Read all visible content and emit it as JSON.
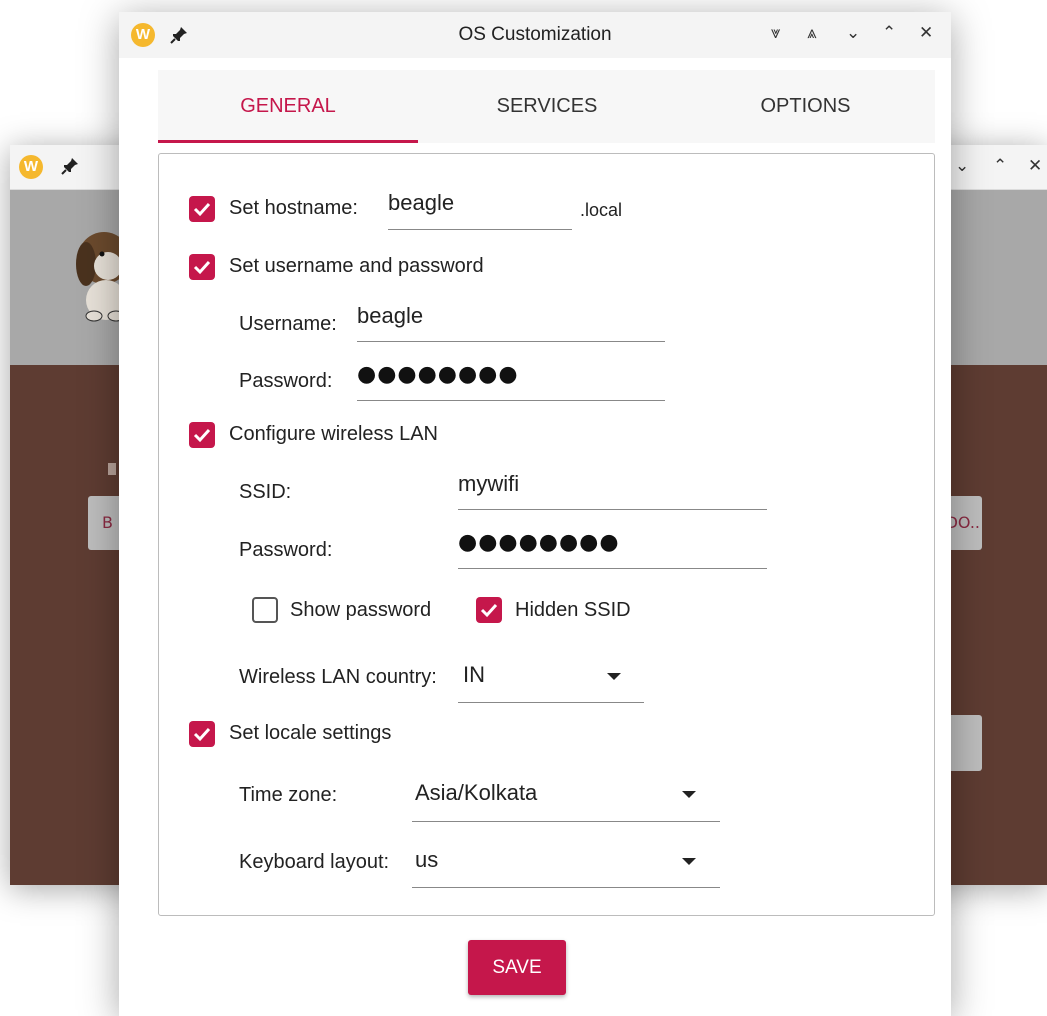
{
  "background_window": {
    "controls": [
      "⌄",
      "⌃",
      "✕"
    ],
    "partial_button_left": "B",
    "partial_button_right": "DO.."
  },
  "dialog": {
    "title": "OS Customization",
    "controls": [
      "⩔",
      "⩓",
      "⌄",
      "⌃",
      "✕"
    ]
  },
  "tabs": [
    {
      "label": "GENERAL",
      "active": true
    },
    {
      "label": "SERVICES",
      "active": false
    },
    {
      "label": "OPTIONS",
      "active": false
    }
  ],
  "general": {
    "hostname": {
      "label": "Set hostname:",
      "checked": true,
      "value": "beagle",
      "suffix": ".local"
    },
    "user": {
      "label": "Set username and password",
      "checked": true,
      "username_label": "Username:",
      "username_value": "beagle",
      "password_label": "Password:",
      "password_value": "●●●●●●●●"
    },
    "wlan": {
      "label": "Configure wireless LAN",
      "checked": true,
      "ssid_label": "SSID:",
      "ssid_value": "mywifi",
      "password_label": "Password:",
      "password_value": "●●●●●●●●",
      "show_password_label": "Show password",
      "show_password_checked": false,
      "hidden_ssid_label": "Hidden SSID",
      "hidden_ssid_checked": true,
      "country_label": "Wireless LAN country:",
      "country_value": "IN"
    },
    "locale": {
      "label": "Set locale settings",
      "checked": true,
      "timezone_label": "Time zone:",
      "timezone_value": "Asia/Kolkata",
      "keyboard_label": "Keyboard layout:",
      "keyboard_value": "us"
    }
  },
  "save_label": "SAVE",
  "colors": {
    "accent": "#c5174b",
    "background_window": "#5e3c32",
    "header_gray": "#a8a8a8"
  }
}
